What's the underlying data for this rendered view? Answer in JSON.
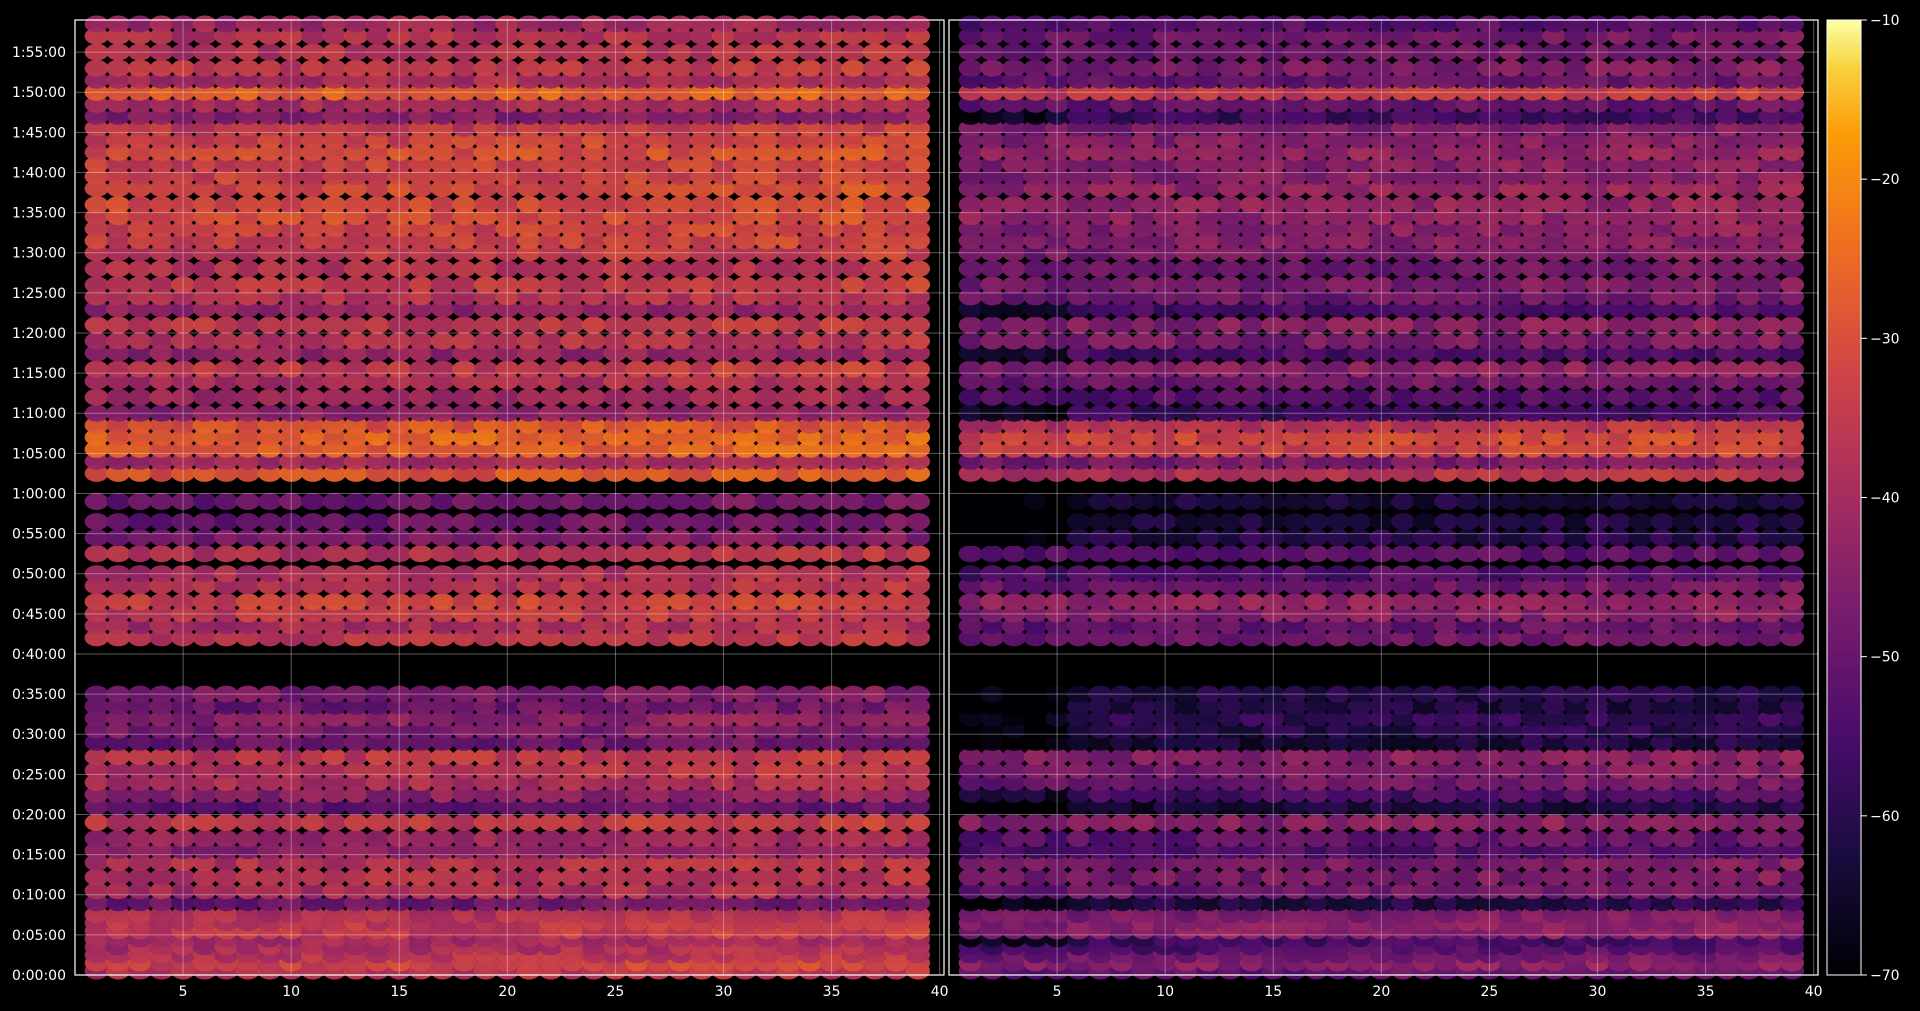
{
  "chart_data": {
    "type": "heatmap",
    "title": "",
    "colormap": "inferno",
    "background": "#000000",
    "grid": true,
    "panels": [
      {
        "name": "",
        "xlim": [
          1,
          40
        ],
        "x_ticks": [
          "5",
          "10",
          "15",
          "20",
          "25",
          "30",
          "35",
          "40"
        ]
      },
      {
        "name": "",
        "xlim": [
          1,
          40
        ],
        "x_ticks": [
          "5",
          "10",
          "15",
          "20",
          "25",
          "30",
          "35",
          "40"
        ]
      }
    ],
    "y_tick_labels": [
      "0:00:00",
      "0:05:00",
      "0:10:00",
      "0:15:00",
      "0:20:00",
      "0:25:00",
      "0:30:00",
      "0:35:00",
      "0:40:00",
      "0:45:00",
      "0:50:00",
      "0:55:00",
      "1:00:00",
      "1:05:00",
      "1:10:00",
      "1:15:00",
      "1:20:00",
      "1:25:00",
      "1:30:00",
      "1:35:00",
      "1:40:00",
      "1:45:00",
      "1:50:00",
      "1:55:00"
    ],
    "ylim": [
      "0:00:00",
      "1:59:00"
    ],
    "colorbar": {
      "min": -70,
      "max": -10,
      "ticks": [
        "-10",
        "-20",
        "-30",
        "-40",
        "-50",
        "-60",
        "-70"
      ]
    },
    "row_levels_min": [
      {
        "t": 0.5,
        "p1": -38,
        "p2": -52
      },
      {
        "t": 1.5,
        "p1": -34,
        "p2": -46
      },
      {
        "t": 2.5,
        "p1": -38,
        "p2": -50
      },
      {
        "t": 3.5,
        "p1": -40,
        "p2": -55
      },
      {
        "t": 4.5,
        "p1": -42,
        "p2": -58
      },
      {
        "t": 5.5,
        "p1": -36,
        "p2": -45
      },
      {
        "t": 6.5,
        "p1": -37,
        "p2": -46
      },
      {
        "t": 7.5,
        "p1": -39,
        "p2": -48
      },
      {
        "t": 9.0,
        "p1": -50,
        "p2": -62
      },
      {
        "t": 10.5,
        "p1": -40,
        "p2": -50
      },
      {
        "t": 12.2,
        "p1": -38,
        "p2": -48
      },
      {
        "t": 14.0,
        "p1": -38,
        "p2": -48
      },
      {
        "t": 15.5,
        "p1": -45,
        "p2": -55
      },
      {
        "t": 17.0,
        "p1": -42,
        "p2": -52
      },
      {
        "t": 19.0,
        "p1": -36,
        "p2": -46
      },
      {
        "t": 21.0,
        "p1": -52,
        "p2": -64
      },
      {
        "t": 22.5,
        "p1": -45,
        "p2": -56
      },
      {
        "t": 24.0,
        "p1": -40,
        "p2": -50
      },
      {
        "t": 25.5,
        "p1": -38,
        "p2": -48
      },
      {
        "t": 27.2,
        "p1": -36,
        "p2": -46
      },
      {
        "t": 29.0,
        "p1": -50,
        "p2": -64
      },
      {
        "t": 30.5,
        "p1": -48,
        "p2": -62
      },
      {
        "t": 32.0,
        "p1": -45,
        "p2": -60
      },
      {
        "t": 33.5,
        "p1": -50,
        "p2": -64
      },
      {
        "t": 35.0,
        "p1": -48,
        "p2": -62
      },
      {
        "t": 42.0,
        "p1": -37,
        "p2": -50
      },
      {
        "t": 43.5,
        "p1": -40,
        "p2": -52
      },
      {
        "t": 45.0,
        "p1": -36,
        "p2": -46
      },
      {
        "t": 46.5,
        "p1": -34,
        "p2": -44
      },
      {
        "t": 48.5,
        "p1": -38,
        "p2": -50
      },
      {
        "t": 50.0,
        "p1": -40,
        "p2": -55
      },
      {
        "t": 52.5,
        "p1": -38,
        "p2": -54
      },
      {
        "t": 54.5,
        "p1": -48,
        "p2": -62
      },
      {
        "t": 56.5,
        "p1": -50,
        "p2": -64
      },
      {
        "t": 59.0,
        "p1": -50,
        "p2": -64
      },
      {
        "t": 62.5,
        "p1": -30,
        "p2": -38
      },
      {
        "t": 64.0,
        "p1": -40,
        "p2": -48
      },
      {
        "t": 65.5,
        "p1": -28,
        "p2": -34
      },
      {
        "t": 67.0,
        "p1": -27,
        "p2": -33
      },
      {
        "t": 68.5,
        "p1": -30,
        "p2": -38
      },
      {
        "t": 70.0,
        "p1": -45,
        "p2": -58
      },
      {
        "t": 72.0,
        "p1": -42,
        "p2": -54
      },
      {
        "t": 74.0,
        "p1": -40,
        "p2": -50
      },
      {
        "t": 75.5,
        "p1": -36,
        "p2": -46
      },
      {
        "t": 77.5,
        "p1": -44,
        "p2": -56
      },
      {
        "t": 79.0,
        "p1": -38,
        "p2": -48
      },
      {
        "t": 81.0,
        "p1": -36,
        "p2": -46
      },
      {
        "t": 83.0,
        "p1": -44,
        "p2": -56
      },
      {
        "t": 84.5,
        "p1": -38,
        "p2": -50
      },
      {
        "t": 86.0,
        "p1": -36,
        "p2": -48
      },
      {
        "t": 88.0,
        "p1": -38,
        "p2": -50
      },
      {
        "t": 90.0,
        "p1": -36,
        "p2": -48
      },
      {
        "t": 91.5,
        "p1": -34,
        "p2": -46
      },
      {
        "t": 93.0,
        "p1": -34,
        "p2": -46
      },
      {
        "t": 94.5,
        "p1": -32,
        "p2": -44
      },
      {
        "t": 96.0,
        "p1": -32,
        "p2": -44
      },
      {
        "t": 98.0,
        "p1": -32,
        "p2": -44
      },
      {
        "t": 99.5,
        "p1": -34,
        "p2": -46
      },
      {
        "t": 101.0,
        "p1": -34,
        "p2": -46
      },
      {
        "t": 102.5,
        "p1": -32,
        "p2": -44
      },
      {
        "t": 104.0,
        "p1": -34,
        "p2": -46
      },
      {
        "t": 105.5,
        "p1": -36,
        "p2": -48
      },
      {
        "t": 107.0,
        "p1": -46,
        "p2": -58
      },
      {
        "t": 108.5,
        "p1": -40,
        "p2": -52
      },
      {
        "t": 110.0,
        "p1": -28,
        "p2": -36
      },
      {
        "t": 111.5,
        "p1": -40,
        "p2": -52
      },
      {
        "t": 113.0,
        "p1": -36,
        "p2": -48
      },
      {
        "t": 115.0,
        "p1": -38,
        "p2": -50
      },
      {
        "t": 117.0,
        "p1": -38,
        "p2": -50
      },
      {
        "t": 118.5,
        "p1": -42,
        "p2": -54
      }
    ]
  }
}
